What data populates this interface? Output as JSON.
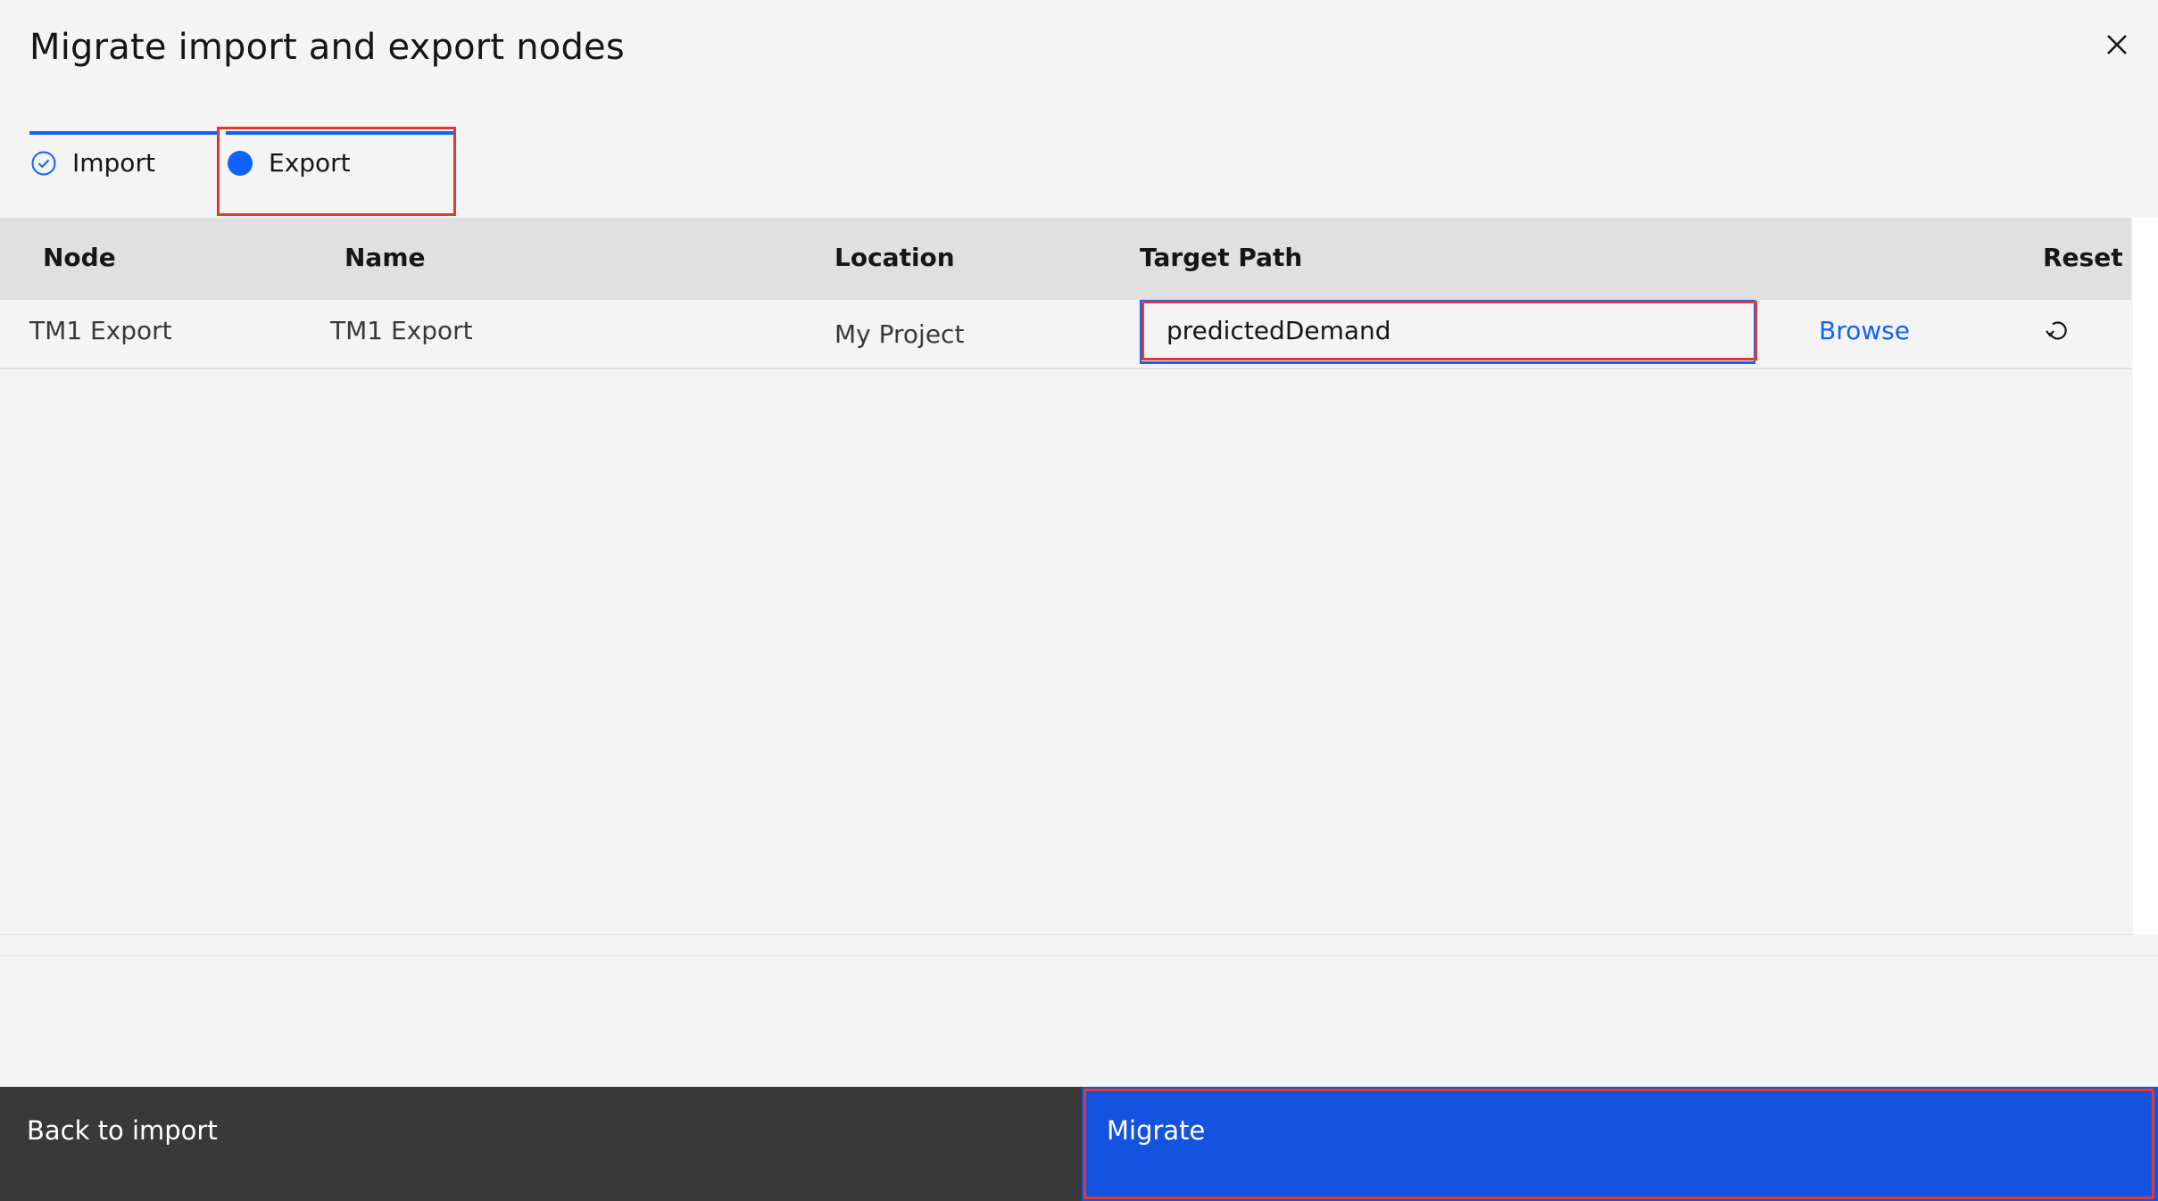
{
  "dialog": {
    "title": "Migrate import and export nodes",
    "close_label": "Close"
  },
  "steps": [
    {
      "label": "Import",
      "state": "complete"
    },
    {
      "label": "Export",
      "state": "current"
    }
  ],
  "table": {
    "headers": {
      "node": "Node",
      "name": "Name",
      "location": "Location",
      "target_path": "Target Path",
      "reset": "Reset"
    },
    "rows": [
      {
        "node": "TM1 Export",
        "name": "TM1 Export",
        "location": "My Project",
        "target_path": "predictedDemand",
        "browse_label": "Browse",
        "reset_icon": "reset-icon"
      }
    ]
  },
  "footer": {
    "secondary_label": "Back to import",
    "primary_label": "Migrate"
  },
  "colors": {
    "accent": "#0f62fe",
    "primary_button": "#1353e0",
    "secondary_button": "#393939",
    "highlight": "#e03a2f"
  }
}
